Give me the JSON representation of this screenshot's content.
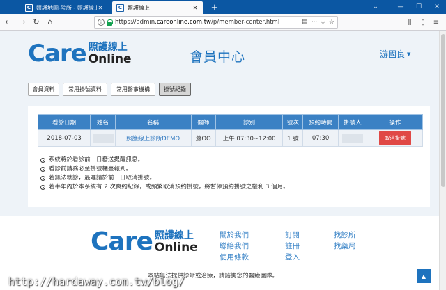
{
  "browser": {
    "tabs": [
      {
        "title": "照護地圖-院所 - 照護線上",
        "active": false,
        "favicon": "C"
      },
      {
        "title": "照護線上",
        "active": true,
        "favicon": "C"
      }
    ],
    "new_tab": "+",
    "url_prefix": "https://admin.",
    "url_host": "careonline.com.tw",
    "url_path": "/p/member-center.html"
  },
  "header": {
    "logo_care": "Care",
    "logo_zh": "照護線上",
    "logo_online": "Online",
    "page_title": "會員中心",
    "user_name": "游國良"
  },
  "buttons": [
    "會員資料",
    "常用掛號資料",
    "常用醫事機構",
    "掛號紀錄"
  ],
  "active_button": 3,
  "table": {
    "headers": [
      "看診日期",
      "姓名",
      "名稱",
      "醫師",
      "診別",
      "號次",
      "預約時間",
      "掛號人",
      "操作"
    ],
    "rows": [
      {
        "date": "2018-07-03",
        "clinic": "照護線上診所DEMO",
        "doctor": "蕭OO",
        "session": "上午 07:30~12:00",
        "number": "1 號",
        "time": "07:30",
        "action": "取消掛號"
      }
    ]
  },
  "notes": [
    "系統將於看診前一日發送提醒訊息。",
    "看診前請務必至掛號櫃臺報到。",
    "若無法就診，最遲請於前一日取消掛號。",
    "若半年內於本系統有 2 次爽約紀錄，或頻繁取消預約掛號，將暫停預約掛號之權利 3 個月。"
  ],
  "footer": {
    "col1": [
      "關於我們",
      "聯絡我們",
      "使用條款"
    ],
    "col2": [
      "訂閱",
      "註冊",
      "登入"
    ],
    "col3": [
      "找診所",
      "找藥局"
    ],
    "disclaimer": "本站無法提供診斷或治療，請諮詢您的醫療團隊。",
    "back_top": "▲"
  },
  "watermark": "http://hardaway.com.tw/blog/",
  "colors": {
    "brand": "#1e73be",
    "tab_bar": "#0b57a3",
    "table_header": "#3b81c4",
    "cancel": "#e04845"
  }
}
